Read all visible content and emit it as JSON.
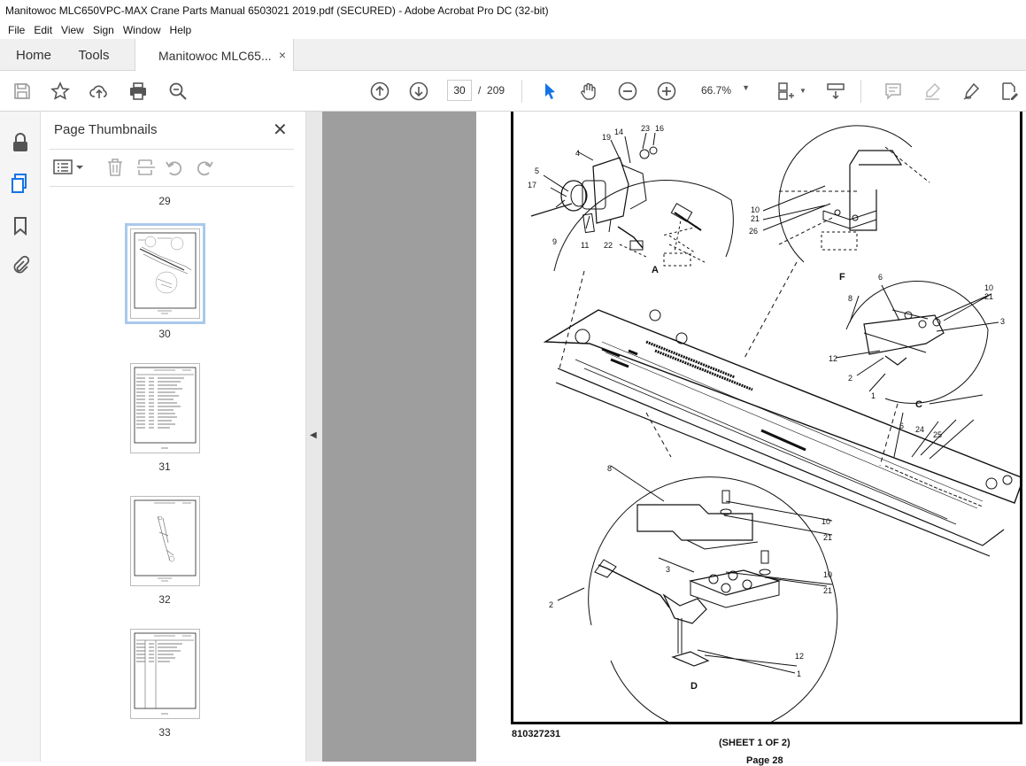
{
  "window": {
    "title": "Manitowoc MLC650VPC-MAX Crane Parts Manual 6503021 2019.pdf (SECURED) - Adobe Acrobat Pro DC (32-bit)"
  },
  "menu": [
    "File",
    "Edit",
    "View",
    "Sign",
    "Window",
    "Help"
  ],
  "tabs": {
    "home": "Home",
    "tools": "Tools",
    "document": "Manitowoc MLC65...",
    "close": "×"
  },
  "toolbar": {
    "current_page": "30",
    "page_sep": "/",
    "total_pages": "209",
    "zoom": "66.7%"
  },
  "panel": {
    "title": "Page Thumbnails",
    "close": "✕",
    "thumbnails": [
      {
        "label": "29"
      },
      {
        "label": "30"
      },
      {
        "label": "31"
      },
      {
        "label": "32"
      },
      {
        "label": "33"
      }
    ]
  },
  "pdf": {
    "drawing_number": "810327231",
    "sheet": "(SHEET 1 OF 2)",
    "page_label": "Page 28",
    "callouts": {
      "view_a": "A",
      "view_c": "C",
      "view_d": "D",
      "view_f": "F",
      "n1": "1",
      "n2": "2",
      "n3": "3",
      "n4": "4",
      "n5": "5",
      "n6": "6",
      "n8": "8",
      "n9": "9",
      "n10": "10",
      "n11": "11",
      "n12": "12",
      "n14": "14",
      "n16": "16",
      "n17": "17",
      "n19": "19",
      "n21": "21",
      "n22": "22",
      "n23": "23",
      "n24": "24",
      "n25": "25",
      "n26": "26"
    }
  },
  "colors": {
    "viewer_bg": "#9e9e9e",
    "accent_blue": "#1473e6",
    "selected_outline": "#a9c9ec"
  }
}
